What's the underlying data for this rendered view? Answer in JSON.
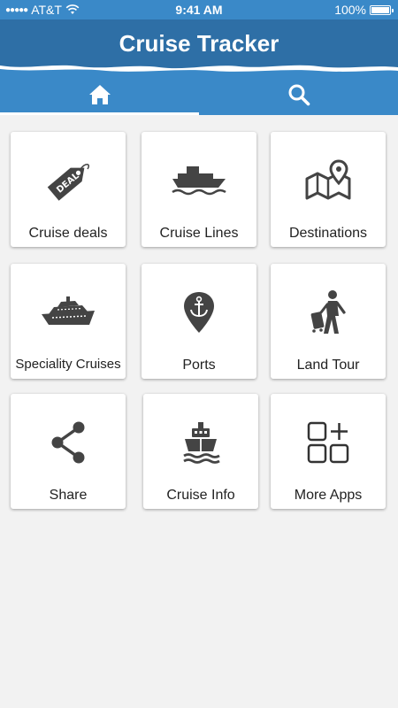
{
  "status_bar": {
    "carrier": "AT&T",
    "time": "9:41 AM",
    "battery": "100%"
  },
  "header": {
    "title": "Cruise Tracker"
  },
  "tabs": [
    {
      "icon": "home-icon",
      "selected": true
    },
    {
      "icon": "search-icon",
      "selected": false
    }
  ],
  "tiles": [
    {
      "label": "Cruise deals",
      "icon": "deal-tag-icon"
    },
    {
      "label": "Cruise Lines",
      "icon": "ship-icon"
    },
    {
      "label": "Destinations",
      "icon": "map-pin-icon"
    },
    {
      "label": "Speciality Cruises",
      "icon": "cruise-ship-icon"
    },
    {
      "label": "Ports",
      "icon": "anchor-pin-icon"
    },
    {
      "label": "Land Tour",
      "icon": "traveler-icon"
    },
    {
      "label": "Share",
      "icon": "share-icon"
    },
    {
      "label": "Cruise Info",
      "icon": "cruise-front-icon"
    },
    {
      "label": "More Apps",
      "icon": "more-apps-icon"
    }
  ],
  "colors": {
    "status_bar": "#3a89c8",
    "header": "#2e6fa6",
    "tabbar": "#3a89c8",
    "icon": "#444444"
  }
}
